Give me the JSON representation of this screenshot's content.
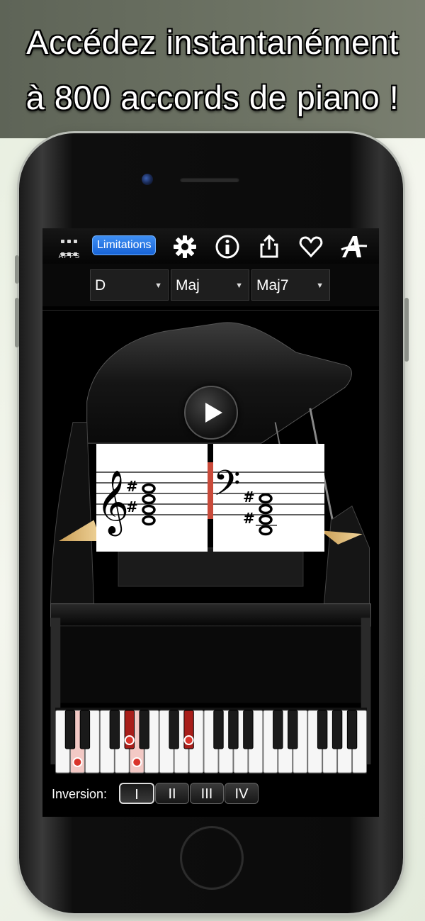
{
  "banner": {
    "line1": "Accédez instantanément",
    "line2": "à 800 accords de piano !"
  },
  "toolbar": {
    "apps_label": "APPS",
    "limitations_label": "Limitations",
    "icons": [
      "gear-icon",
      "info-icon",
      "share-icon",
      "heart-icon",
      "font-icon"
    ]
  },
  "selectors": {
    "root": "D",
    "quality": "Maj",
    "extension": "Maj7"
  },
  "inversion": {
    "label": "Inversion:",
    "options": [
      "I",
      "II",
      "III",
      "IV"
    ],
    "selected": "I"
  },
  "colors": {
    "accent": "#2a7ce8",
    "highlight_key": "#d9342b"
  }
}
